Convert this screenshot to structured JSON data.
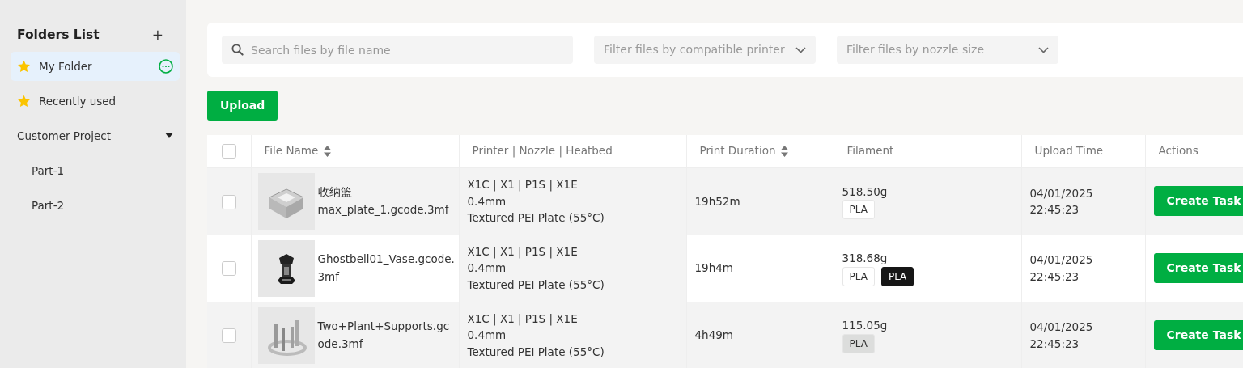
{
  "sidebar": {
    "title": "Folders List",
    "add_icon": "+",
    "items": [
      {
        "label": "My Folder",
        "kind": "starred",
        "selected": true
      },
      {
        "label": "Recently used",
        "kind": "starred",
        "selected": false
      },
      {
        "label": "Customer Project",
        "kind": "group",
        "selected": false,
        "expanded": true,
        "children": [
          {
            "label": "Part-1",
            "kind": "child",
            "selected": false
          },
          {
            "label": "Part-2",
            "kind": "child",
            "selected": false
          }
        ]
      }
    ]
  },
  "filters": {
    "search": {
      "placeholder": "Search files by file name"
    },
    "printer": {
      "placeholder": "Filter files by compatible printer"
    },
    "nozzle": {
      "placeholder": "Filter files by nozzle size"
    }
  },
  "upload_button": "Upload",
  "table": {
    "select_all_checked": false,
    "columns": [
      {
        "label": "File Name",
        "sortable": true
      },
      {
        "label": "Printer | Nozzle | Heatbed",
        "sortable": false
      },
      {
        "label": "Print Duration",
        "sortable": true
      },
      {
        "label": "Filament",
        "sortable": false
      },
      {
        "label": "Upload Time",
        "sortable": false
      },
      {
        "label": "Actions",
        "sortable": false
      }
    ],
    "rows": [
      {
        "checked": false,
        "thumbnail": {
          "kind": "picture"
        },
        "file_name": "收纳篮\nmax_plate_1.gcode.3mf",
        "printers": "X1C | X1 | P1S | X1E",
        "nozzle": "0.4mm",
        "heatbed": "Textured PEI Plate (55°C)",
        "duration": "19h52m",
        "weight": "518.50g",
        "filaments": [
          {
            "label": "PLA",
            "color": "#ffffff"
          }
        ],
        "date": "04/01/2025",
        "time": "22:45:23",
        "action": "Create Task"
      },
      {
        "checked": false,
        "thumbnail": {
          "kind": "picture"
        },
        "file_name": "Ghostbell01_Vase.gcode.\n3mf",
        "printers": "X1C | X1 | P1S | X1E",
        "nozzle": "0.4mm",
        "heatbed": "Textured PEI Plate (55°C)",
        "duration": "19h4m",
        "weight": "318.68g",
        "filaments": [
          {
            "label": "PLA",
            "color": "#ffffff"
          },
          {
            "label": "PLA",
            "color": "#161616"
          }
        ],
        "date": "04/01/2025",
        "time": "22:45:23",
        "action": "Create Task"
      },
      {
        "checked": false,
        "thumbnail": {
          "kind": "picture"
        },
        "file_name": "Two+Plant+Supports.gc\node.3mf",
        "printers": "X1C | X1 | P1S | X1E",
        "nozzle": "0.4mm",
        "heatbed": "Textured PEI Plate (55°C)",
        "duration": "4h49m",
        "weight": "115.05g",
        "filaments": [
          {
            "label": "PLA",
            "color": "#dcdddc"
          }
        ],
        "date": "04/01/2025",
        "time": "22:45:23",
        "action": "Create Task"
      }
    ]
  }
}
